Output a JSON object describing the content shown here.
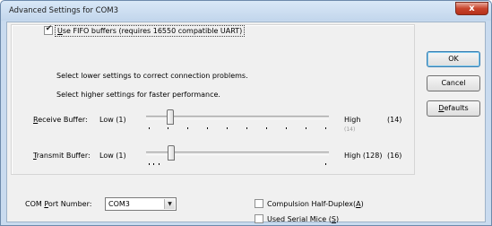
{
  "window": {
    "title": "Advanced Settings for COM3",
    "close_glyph": "x"
  },
  "fifo": {
    "checked": true,
    "check_glyph": "✔",
    "label_prefix": "",
    "label_accel": "U",
    "label_rest": "se FIFO buffers (requires 16550 compatible UART)"
  },
  "hints": {
    "lower": "Select lower settings to correct connection problems.",
    "higher": "Select higher settings for faster performance."
  },
  "receive": {
    "label_accel": "R",
    "label_rest": "eceive Buffer:",
    "low": "Low (1)",
    "high": "High",
    "high_sub": "(14)",
    "value": "(14)"
  },
  "transmit": {
    "label_accel": "T",
    "label_rest": "ransmit Buffer:",
    "low": "Low (1)",
    "high": "High (128)",
    "value": "(16)"
  },
  "buttons": {
    "ok": "OK",
    "cancel": "Cancel",
    "defaults_accel": "D",
    "defaults_rest": "efaults"
  },
  "com_port": {
    "label_pre": "COM ",
    "label_accel": "P",
    "label_rest": "ort Number:",
    "value": "COM3",
    "arrow_glyph": "▼"
  },
  "options": {
    "half_duplex": {
      "checked": false,
      "label": "Compulsion Half-Duplex(",
      "accel": "A",
      "suffix": ")"
    },
    "serial_mice": {
      "checked": false,
      "label": "Used Serial Mice (",
      "accel": "S",
      "suffix": ")"
    }
  }
}
